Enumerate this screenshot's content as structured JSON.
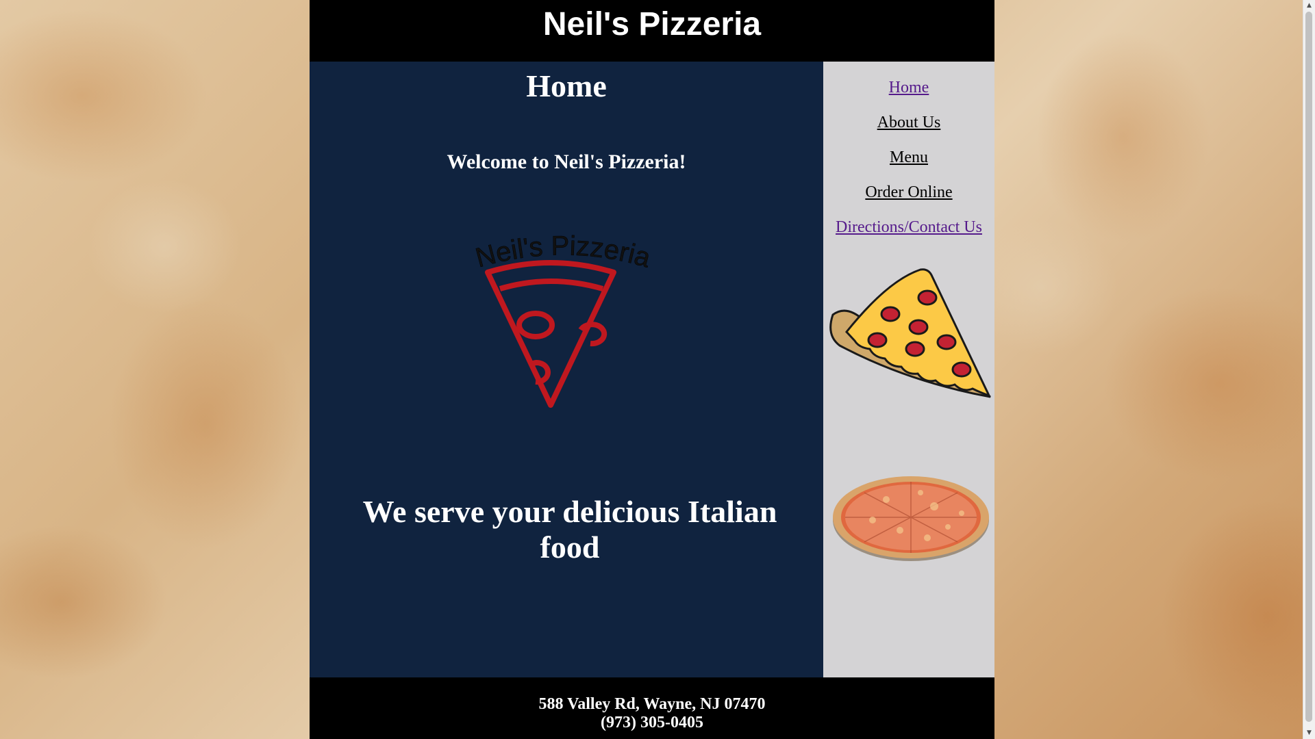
{
  "header": {
    "title": "Neil's Pizzeria"
  },
  "main": {
    "heading": "Home",
    "welcome": "Welcome to Neil's Pizzeria!",
    "logo": {
      "curved_text": "Neil's Pizzeria",
      "icon": "pizza-slice-outline-icon",
      "color": "#c0181f"
    },
    "tagline": "We serve your delicious Italian food"
  },
  "sidebar": {
    "nav": [
      {
        "label": "Home",
        "visited": true
      },
      {
        "label": "About Us",
        "visited": false
      },
      {
        "label": "Menu",
        "visited": false
      },
      {
        "label": "Order Online",
        "visited": false
      },
      {
        "label": "Directions/Contact Us",
        "visited": true
      }
    ],
    "images": [
      "pepperoni-slice-illustration",
      "whole-pizza-photo"
    ]
  },
  "footer": {
    "address": "588 Valley Rd, Wayne, NJ 07470",
    "phone": "(973) 305-0405"
  },
  "colors": {
    "header_bg": "#000000",
    "main_bg": "#10233f",
    "sidebar_bg": "#d4d3d5",
    "link_visited": "#551a8b",
    "text_light": "#ffffff"
  }
}
